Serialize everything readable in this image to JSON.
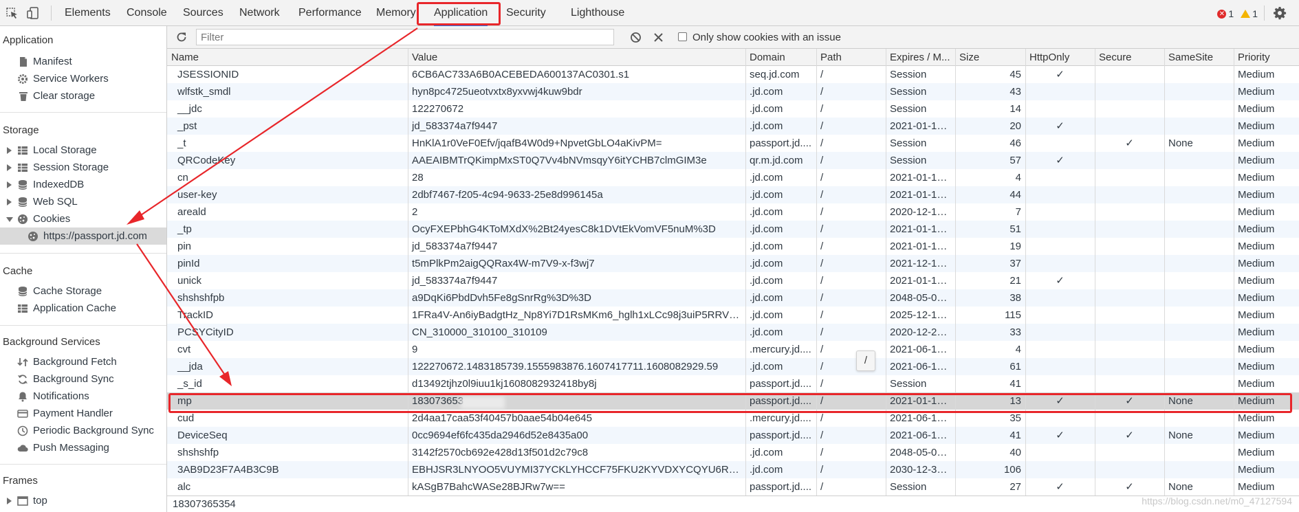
{
  "topbar": {
    "tabs": [
      "Elements",
      "Console",
      "Sources",
      "Network",
      "Performance",
      "Memory",
      "Application",
      "Security",
      "Lighthouse"
    ],
    "selected_tab": "Application",
    "error_count": "1",
    "warning_count": "1"
  },
  "sidebar": {
    "application_header": "Application",
    "application_items": [
      "Manifest",
      "Service Workers",
      "Clear storage"
    ],
    "storage_header": "Storage",
    "storage_items": [
      "Local Storage",
      "Session Storage",
      "IndexedDB",
      "Web SQL",
      "Cookies"
    ],
    "cookie_origin": "https://passport.jd.com",
    "cache_header": "Cache",
    "cache_items": [
      "Cache Storage",
      "Application Cache"
    ],
    "bg_header": "Background Services",
    "bg_items": [
      "Background Fetch",
      "Background Sync",
      "Notifications",
      "Payment Handler",
      "Periodic Background Sync",
      "Push Messaging"
    ],
    "frames_header": "Frames",
    "frames_items": [
      "top"
    ]
  },
  "toolbar": {
    "filter_placeholder": "Filter",
    "only_issue_label": "Only show cookies with an issue"
  },
  "table": {
    "columns": [
      "Name",
      "Value",
      "Domain",
      "Path",
      "Expires / M...",
      "Size",
      "HttpOnly",
      "Secure",
      "SameSite",
      "Priority"
    ],
    "rows": [
      [
        "JSESSIONID",
        "6CB6AC733A6B0ACEBEDA600137AC0301.s1",
        "seq.jd.com",
        "/",
        "Session",
        "45",
        "✓",
        "",
        "",
        "Medium"
      ],
      [
        "wlfstk_smdl",
        "hyn8pc4725ueotvxtx8yxvwj4kuw9bdr",
        ".jd.com",
        "/",
        "Session",
        "43",
        "",
        "",
        "",
        "Medium"
      ],
      [
        "__jdc",
        "122270672",
        ".jd.com",
        "/",
        "Session",
        "14",
        "",
        "",
        "",
        "Medium"
      ],
      [
        "_pst",
        "jd_583374a7f9447",
        ".jd.com",
        "/",
        "2021-01-15...",
        "20",
        "✓",
        "",
        "",
        "Medium"
      ],
      [
        "_t",
        "HnKlA1r0VeF0Efv/jqafB4W0d9+NpvetGbLO4aKivPM=",
        "passport.jd....",
        "/",
        "Session",
        "46",
        "",
        "✓",
        "None",
        "Medium"
      ],
      [
        "QRCodeKey",
        "AAEAIBMTrQKimpMxST0Q7Vv4bNVmsqyY6itYCHB7clmGIM3e",
        "qr.m.jd.com",
        "/",
        "Session",
        "57",
        "✓",
        "",
        "",
        "Medium"
      ],
      [
        "cn",
        "28",
        ".jd.com",
        "/",
        "2021-01-15...",
        "4",
        "",
        "",
        "",
        "Medium"
      ],
      [
        "user-key",
        "2dbf7467-f205-4c94-9633-25e8d996145a",
        ".jd.com",
        "/",
        "2021-01-15...",
        "44",
        "",
        "",
        "",
        "Medium"
      ],
      [
        "areald",
        "2",
        ".jd.com",
        "/",
        "2020-12-18...",
        "7",
        "",
        "",
        "",
        "Medium"
      ],
      [
        "_tp",
        "OcyFXEPbhG4KToMXdX%2Bt24yesC8k1DVtEkVomVF5nuM%3D",
        ".jd.com",
        "/",
        "2021-01-15...",
        "51",
        "",
        "",
        "",
        "Medium"
      ],
      [
        "pin",
        "jd_583374a7f9447",
        ".jd.com",
        "/",
        "2021-01-15...",
        "19",
        "",
        "",
        "",
        "Medium"
      ],
      [
        "pinId",
        "t5mPlkPm2aigQQRax4W-m7V9-x-f3wj7",
        ".jd.com",
        "/",
        "2021-12-16...",
        "37",
        "",
        "",
        "",
        "Medium"
      ],
      [
        "unick",
        "jd_583374a7f9447",
        ".jd.com",
        "/",
        "2021-01-15...",
        "21",
        "✓",
        "",
        "",
        "Medium"
      ],
      [
        "shshshfpb",
        "a9DqKi6PbdDvh5Fe8gSnrRg%3D%3D",
        ".jd.com",
        "/",
        "2048-05-03...",
        "38",
        "",
        "",
        "",
        "Medium"
      ],
      [
        "TrackID",
        "1FRa4V-An6iyBadgtHz_Np8Yi7D1RsMKm6_hglh1xLCc98j3uiP5RRVJ5ZL...",
        ".jd.com",
        "/",
        "2025-12-15...",
        "115",
        "",
        "",
        "",
        "Medium"
      ],
      [
        "PCSYCityID",
        "CN_310000_310100_310109",
        ".jd.com",
        "/",
        "2020-12-23...",
        "33",
        "",
        "",
        "",
        "Medium"
      ],
      [
        "cvt",
        "9",
        ".mercury.jd....",
        "/",
        "2021-06-14...",
        "4",
        "",
        "",
        "",
        "Medium"
      ],
      [
        "__jda",
        "122270672.1483185739.1555983876.1607417711.1608082929.59",
        ".jd.com",
        "/",
        "2021-06-14...",
        "61",
        "",
        "",
        "",
        "Medium"
      ],
      [
        "_s_id",
        "d13492tjhz0l9iuu1kj1608082932418by8j",
        "passport.jd....",
        "/",
        "Session",
        "41",
        "",
        "",
        "",
        "Medium"
      ],
      [
        "mp",
        "183073653",
        "passport.jd....",
        "/",
        "2021-01-15...",
        "13",
        "✓",
        "✓",
        "None",
        "Medium"
      ],
      [
        "cud",
        "2d4aa17caa53f40457b0aae54b04e645",
        ".mercury.jd....",
        "/",
        "2021-06-14...",
        "35",
        "",
        "",
        "",
        "Medium"
      ],
      [
        "DeviceSeq",
        "0cc9694ef6fc435da2946d52e8435a00",
        "passport.jd....",
        "/",
        "2021-06-14...",
        "41",
        "✓",
        "✓",
        "None",
        "Medium"
      ],
      [
        "shshshfp",
        "3142f2570cb692e428d13f501d2c79c8",
        ".jd.com",
        "/",
        "2048-05-03...",
        "40",
        "",
        "",
        "",
        "Medium"
      ],
      [
        "3AB9D23F7A4B3C9B",
        "EBHJSR3LNYOO5VUYMI37YCKLYHCCF75FKU2KYVDXYCQYU6RFHGLEG...",
        ".jd.com",
        "/",
        "2030-12-31...",
        "106",
        "",
        "",
        "",
        "Medium"
      ],
      [
        "alc",
        "kASgB7BahcWASe28BJRw7w==",
        "passport.jd....",
        "/",
        "Session",
        "27",
        "✓",
        "✓",
        "None",
        "Medium"
      ]
    ]
  },
  "tooltip_text": "/",
  "status_value": "18307365354",
  "watermark": "https://blog.csdn.net/m0_47127594",
  "colors": {
    "accent": "#1a73e8",
    "annotation_red": "#e8262a",
    "error": "#e02b2b",
    "warning": "#f4b400"
  }
}
